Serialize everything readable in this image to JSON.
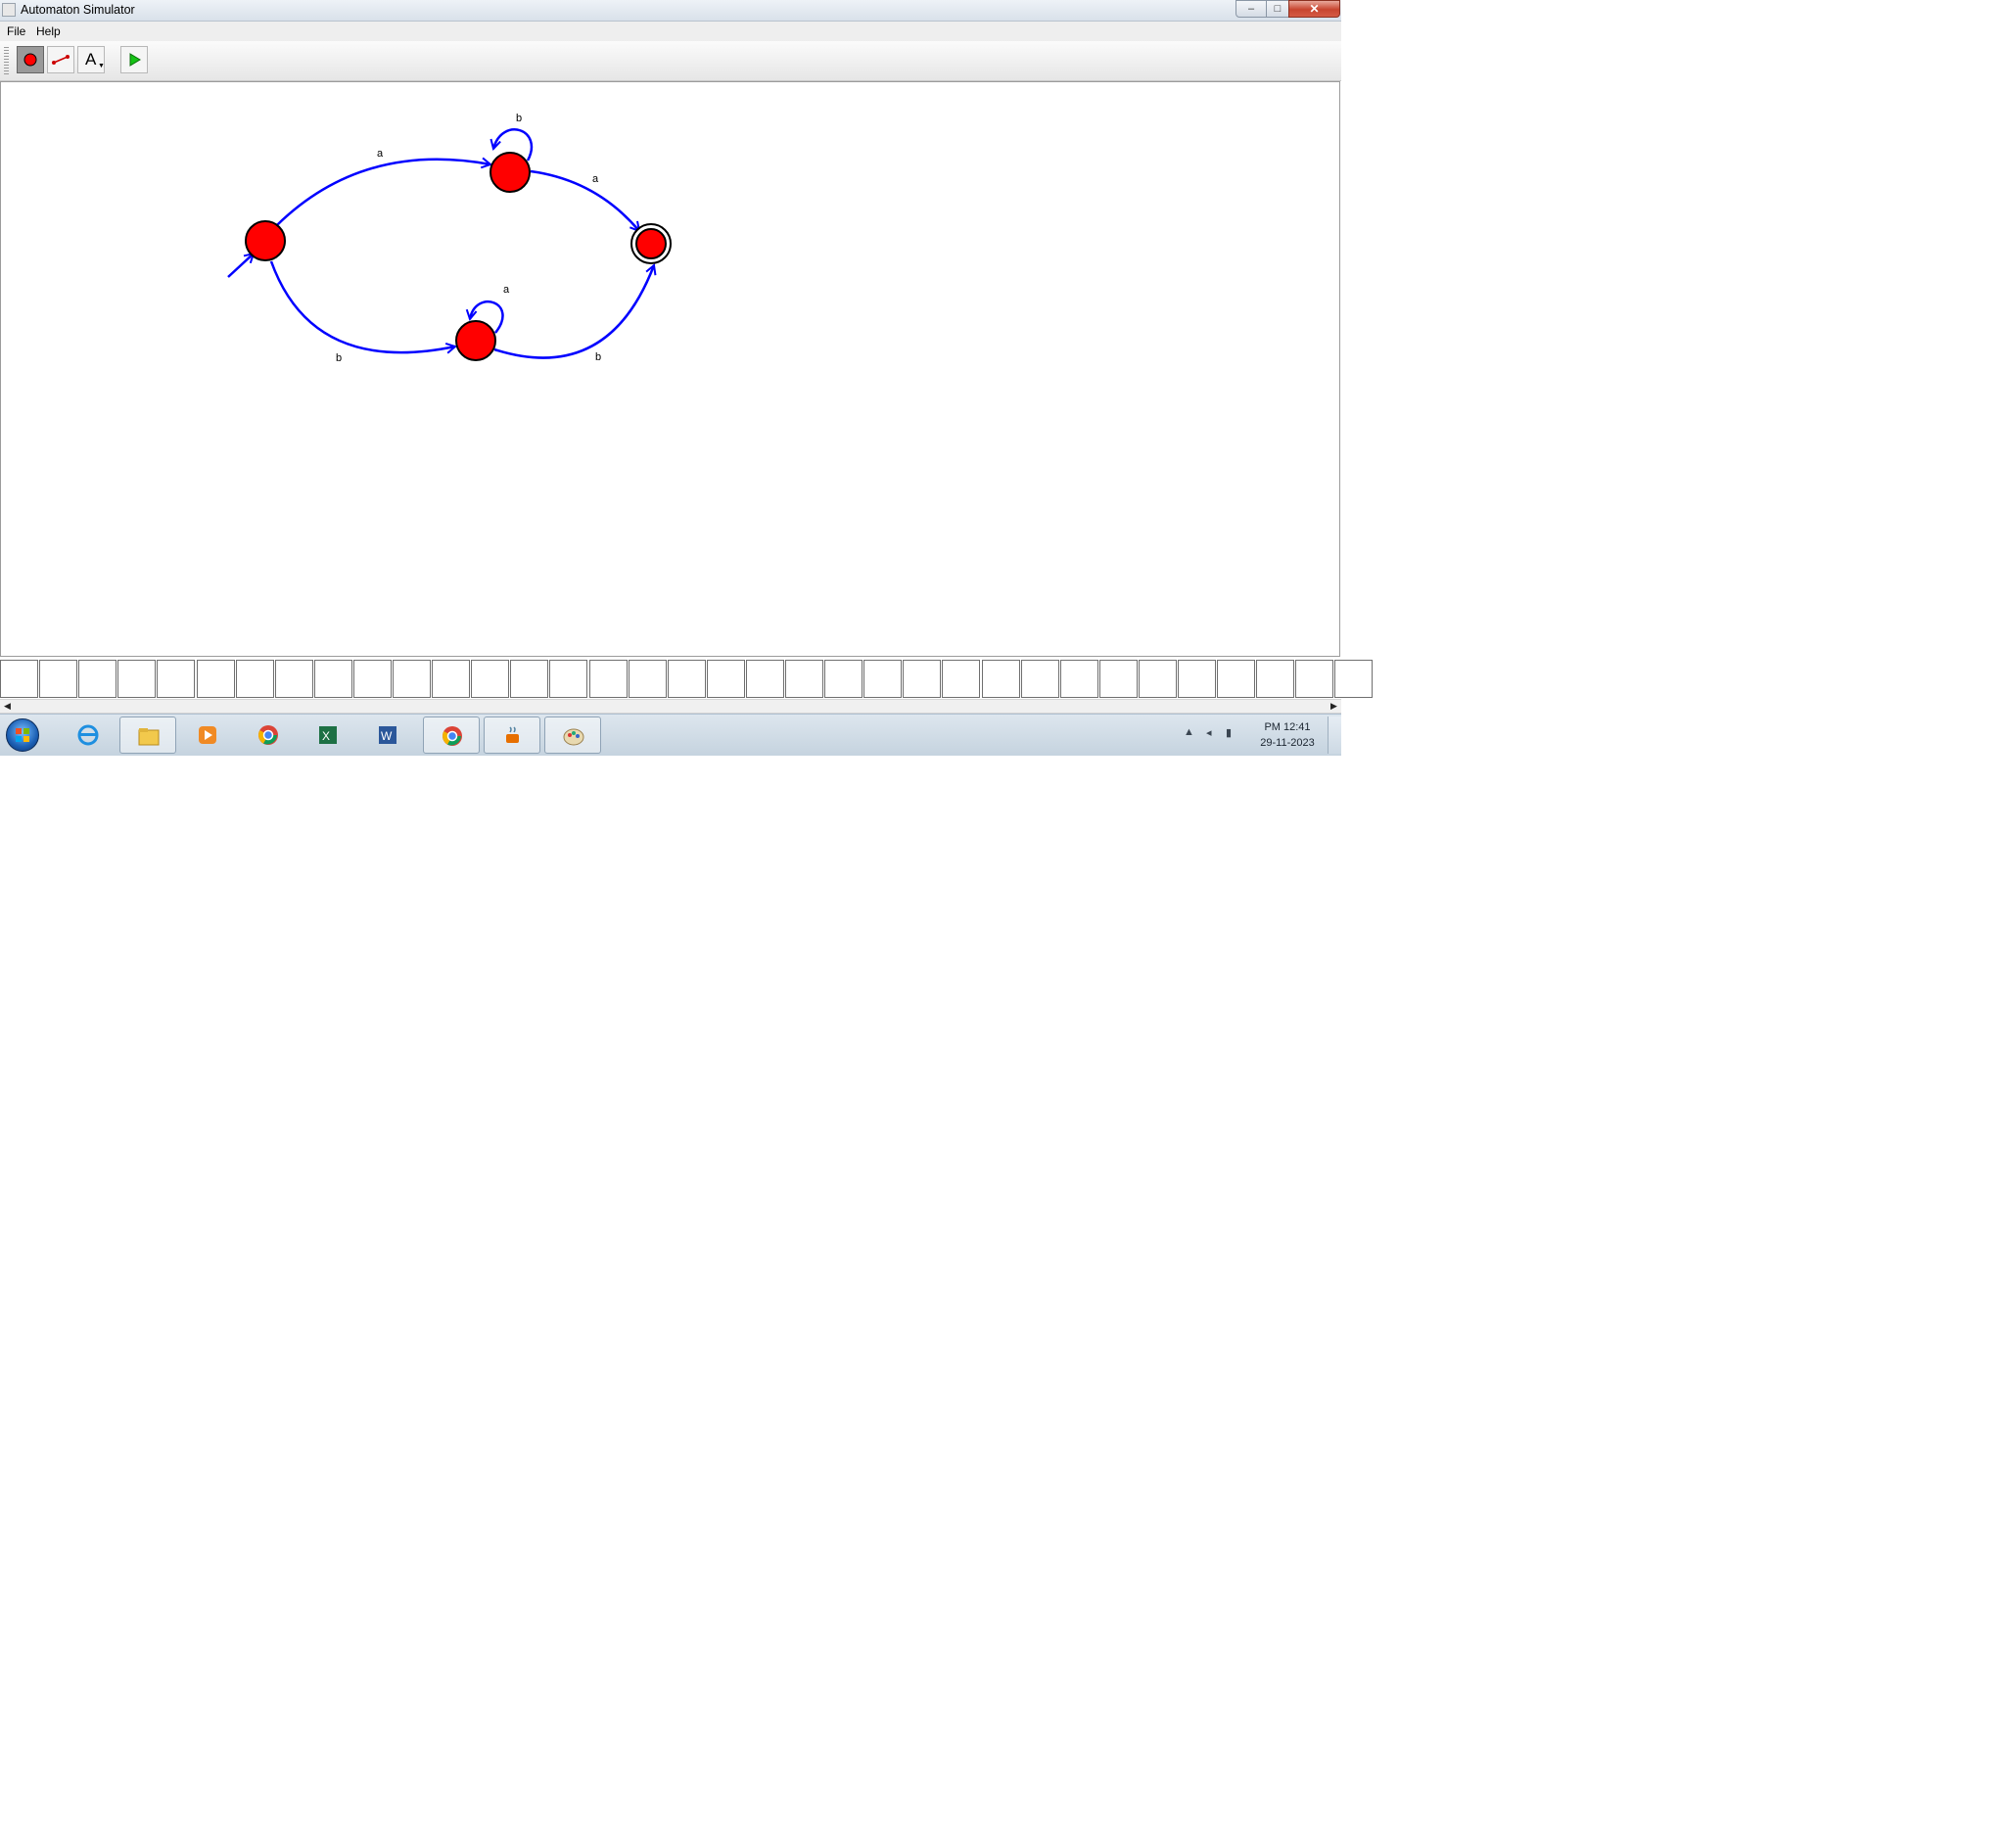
{
  "window": {
    "title": "Automaton Simulator",
    "controls": {
      "minimize": "–",
      "maximize": "□",
      "close": "✕"
    }
  },
  "menu": {
    "items": [
      "File",
      "Help"
    ]
  },
  "toolbar": {
    "tools": [
      {
        "name": "state-tool",
        "icon": "red-circle-icon",
        "selected": true
      },
      {
        "name": "transition-tool",
        "icon": "edge-icon",
        "selected": false
      },
      {
        "name": "label-tool",
        "icon": "text-A-icon",
        "glyph": "A",
        "selected": false
      },
      {
        "name": "run-button",
        "icon": "green-play-icon",
        "selected": false
      }
    ]
  },
  "automaton": {
    "colors": {
      "state_fill": "#ff0000",
      "edge": "#0000ff",
      "outline": "#000000"
    },
    "states": [
      {
        "id": "q0",
        "initial": true,
        "accepting": false
      },
      {
        "id": "q1",
        "initial": false,
        "accepting": false
      },
      {
        "id": "q2",
        "initial": false,
        "accepting": false
      },
      {
        "id": "q3",
        "initial": false,
        "accepting": true
      }
    ],
    "transitions": [
      {
        "from": "q0",
        "to": "q1",
        "label": "a"
      },
      {
        "from": "q1",
        "to": "q1",
        "label": "b"
      },
      {
        "from": "q1",
        "to": "q3",
        "label": "a"
      },
      {
        "from": "q0",
        "to": "q2",
        "label": "b"
      },
      {
        "from": "q2",
        "to": "q2",
        "label": "a"
      },
      {
        "from": "q2",
        "to": "q3",
        "label": "b"
      }
    ]
  },
  "tape": {
    "cells": [
      "",
      "",
      "",
      "",
      "",
      "",
      "",
      "",
      "",
      "",
      "",
      "",
      "",
      "",
      "",
      "",
      "",
      "",
      "",
      "",
      "",
      "",
      "",
      "",
      "",
      "",
      "",
      "",
      "",
      "",
      "",
      "",
      "",
      "",
      ""
    ]
  },
  "taskbar": {
    "apps": [
      {
        "name": "internet-explorer",
        "icon": "ie-icon",
        "active": false
      },
      {
        "name": "file-explorer",
        "icon": "folder-icon",
        "active": true
      },
      {
        "name": "media-player",
        "icon": "media-player-icon",
        "active": false
      },
      {
        "name": "chrome",
        "icon": "chrome-icon",
        "active": false
      },
      {
        "name": "excel",
        "icon": "excel-icon",
        "active": false
      },
      {
        "name": "word",
        "icon": "word-icon",
        "active": false
      },
      {
        "name": "chrome-profile",
        "icon": "chrome-icon",
        "active": true
      },
      {
        "name": "java",
        "icon": "java-icon",
        "active": true
      },
      {
        "name": "paint",
        "icon": "paint-icon",
        "active": true
      }
    ],
    "tray": {
      "time": "PM 12:41",
      "date": "29-11-2023"
    }
  }
}
